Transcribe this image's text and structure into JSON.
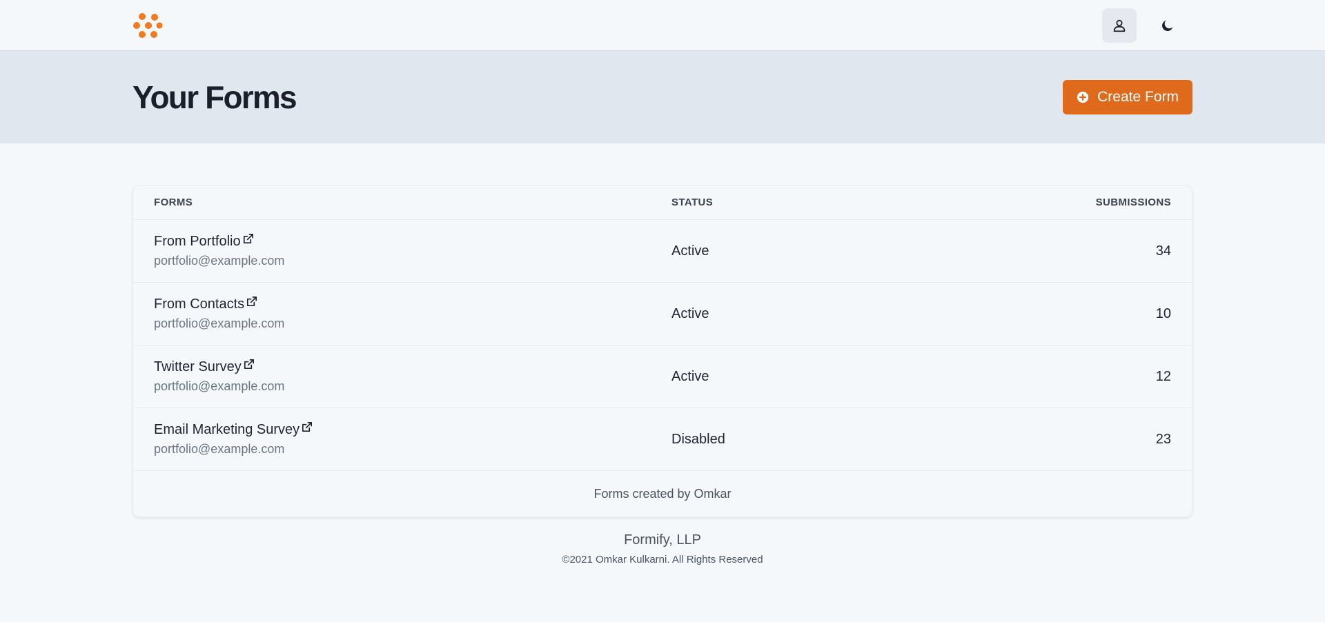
{
  "nav": {
    "logo_icon": "formify-logo-icon",
    "user_icon": "user-icon",
    "theme_icon": "moon-icon"
  },
  "header": {
    "title": "Your Forms",
    "create_label": "Create Form",
    "create_icon": "plus-circle-icon"
  },
  "table": {
    "columns": [
      "FORMS",
      "STATUS",
      "SUBMISSIONS"
    ],
    "rows": [
      {
        "name": "From Portfolio",
        "email": "portfolio@example.com",
        "status": "Active",
        "submissions": "34"
      },
      {
        "name": "From Contacts",
        "email": "portfolio@example.com",
        "status": "Active",
        "submissions": "10"
      },
      {
        "name": "Twitter Survey",
        "email": "portfolio@example.com",
        "status": "Active",
        "submissions": "12"
      },
      {
        "name": "Email Marketing Survey",
        "email": "portfolio@example.com",
        "status": "Disabled",
        "submissions": "23"
      }
    ],
    "footer": "Forms created by Omkar"
  },
  "footer": {
    "company": "Formify, LLP",
    "copyright": "©2021 Omkar Kulkarni. All Rights Reserved"
  },
  "colors": {
    "accent": "#e06a1c",
    "header_band": "#e1e7ef",
    "background": "#f5f8fb"
  }
}
